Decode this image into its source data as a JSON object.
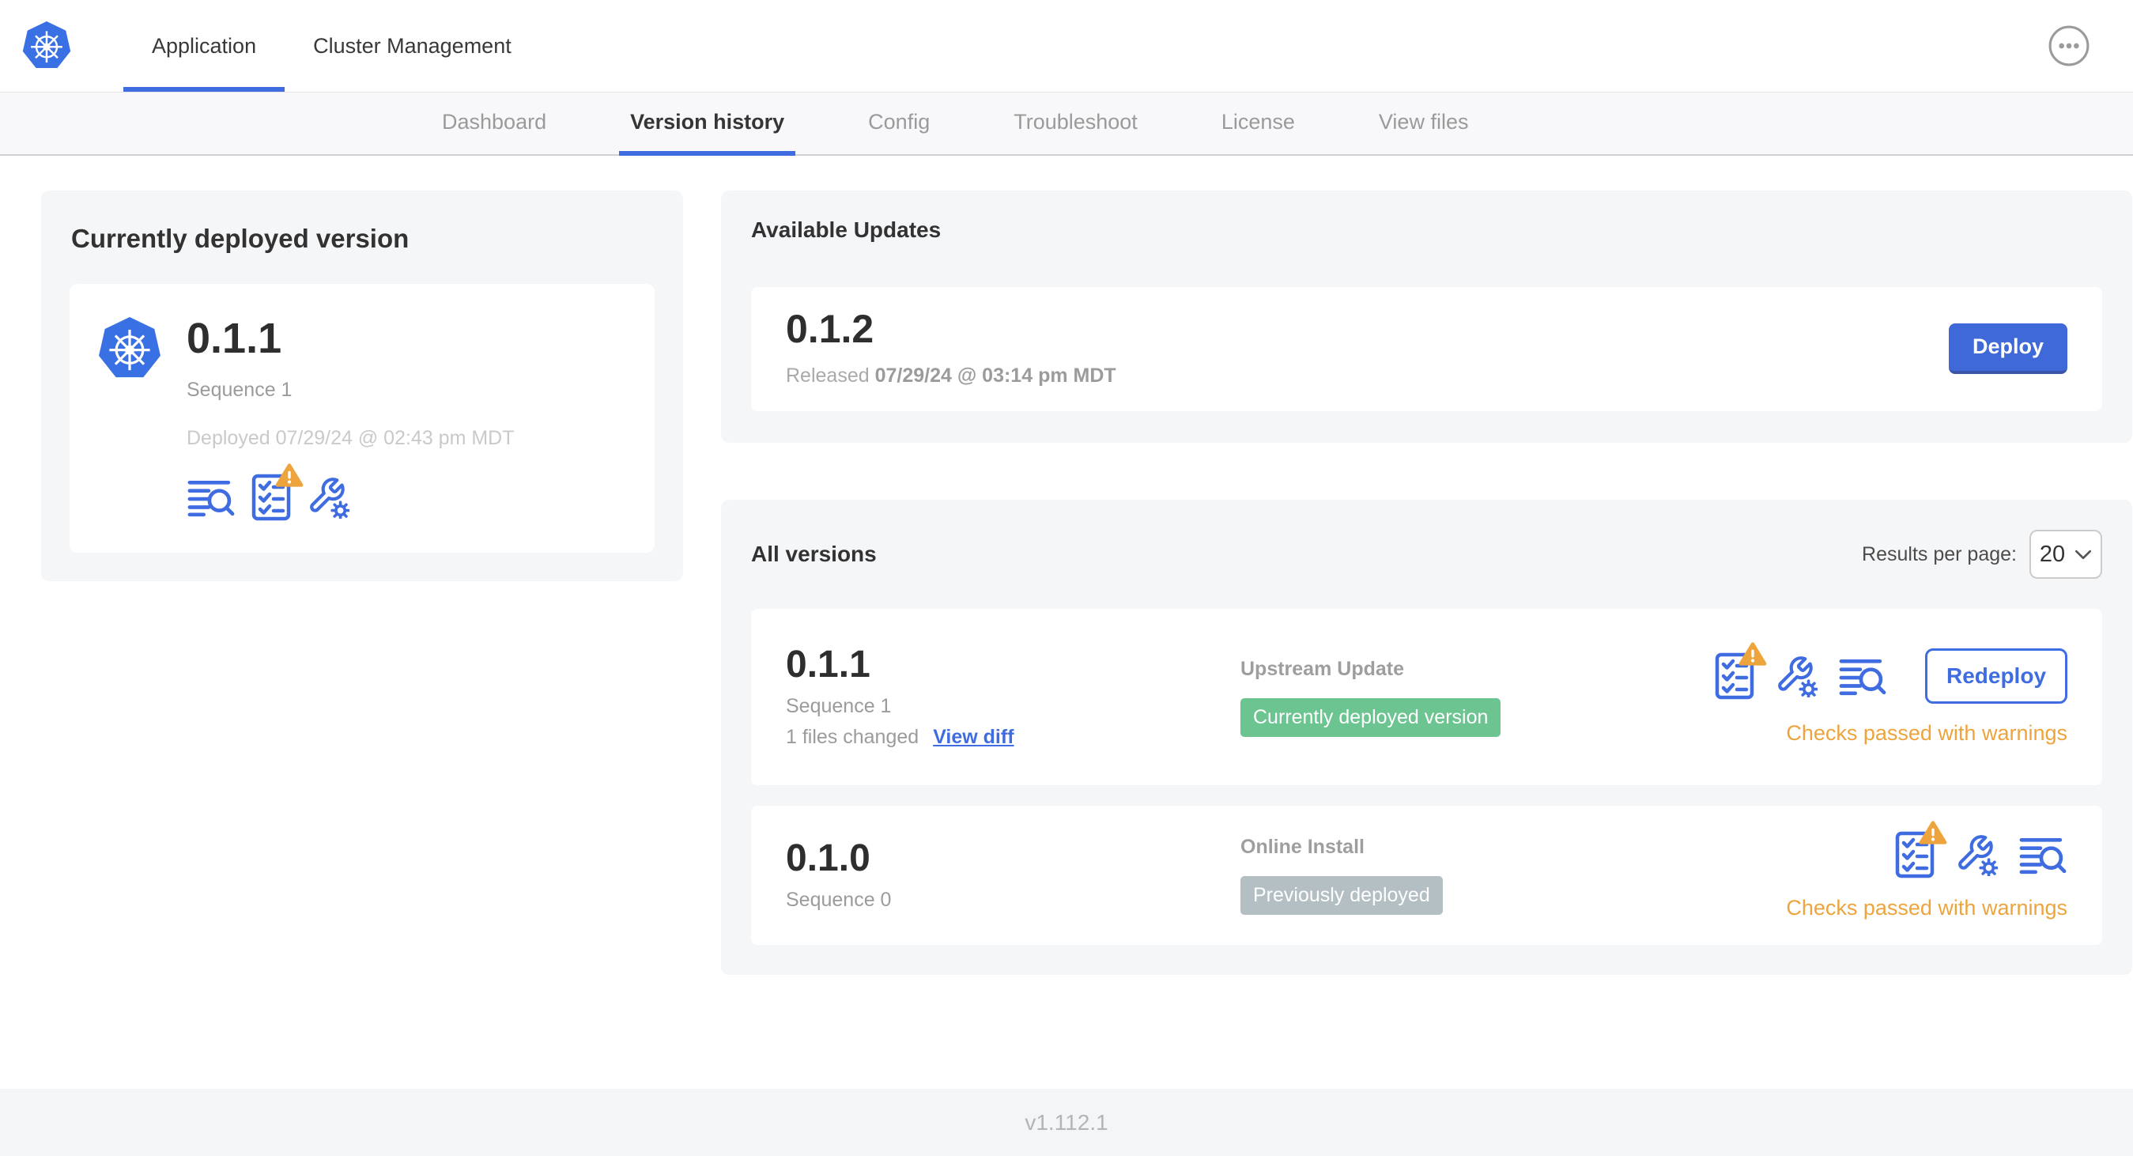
{
  "top_nav": {
    "tabs": [
      {
        "label": "Application",
        "active": true
      },
      {
        "label": "Cluster Management",
        "active": false
      }
    ]
  },
  "sub_nav": {
    "tabs": [
      "Dashboard",
      "Version history",
      "Config",
      "Troubleshoot",
      "License",
      "View files"
    ],
    "active_tab": "Version history"
  },
  "current_version": {
    "title": "Currently deployed version",
    "version": "0.1.1",
    "sequence": "Sequence 1",
    "deployed": "Deployed 07/29/24 @ 02:43 pm MDT"
  },
  "available_updates": {
    "title": "Available Updates",
    "version": "0.1.2",
    "released_prefix": "Released",
    "released_date": "07/29/24 @ 03:14 pm MDT",
    "deploy_label": "Deploy"
  },
  "all_versions": {
    "title": "All versions",
    "results_per_page_label": "Results per page:",
    "results_per_page_value": "20",
    "rows": [
      {
        "version": "0.1.1",
        "sequence": "Sequence 1",
        "files_changed": "1 files changed",
        "view_diff_label": "View diff",
        "source": "Upstream Update",
        "status_badge": "Currently deployed version",
        "status_color": "#6cc491",
        "checks_status": "Checks passed with warnings",
        "action_label": "Redeploy"
      },
      {
        "version": "0.1.0",
        "sequence": "Sequence 0",
        "source": "Online Install",
        "status_badge": "Previously deployed",
        "status_color": "#b3bfc2",
        "checks_status": "Checks passed with warnings"
      }
    ]
  },
  "footer": {
    "app_version": "v1.112.1"
  },
  "icons": {
    "logo": "kubernetes-helm-wheel",
    "overflow": "ellipsis-in-circle",
    "release_notes": "text-lines-with-magnifier",
    "preflight_checks": "checklist-with-warning-triangle",
    "config": "wrench-with-gear",
    "dropdown": "chevron-down"
  },
  "colors": {
    "primary_blue": "#3f6ce0",
    "button_blue": "#3f68d8",
    "k8s_logo_blue": "#3970e4",
    "badge_green": "#6cc491",
    "badge_gray": "#b3bfc2",
    "warning_amber": "#eea43c",
    "card_background": "#f5f6f8"
  }
}
